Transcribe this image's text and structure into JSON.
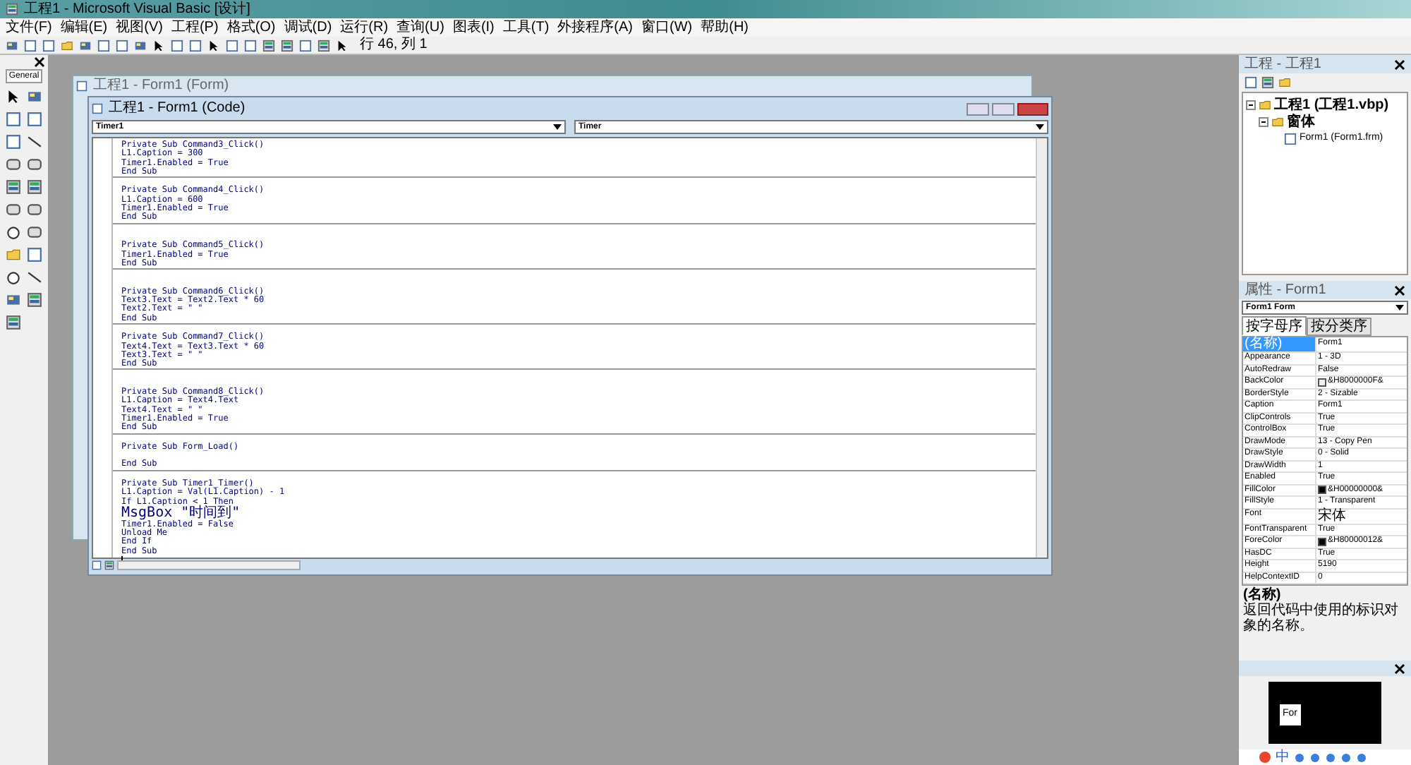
{
  "app": {
    "title": "工程1 - Microsoft Visual Basic [设计]"
  },
  "menu": [
    "文件(F)",
    "编辑(E)",
    "视图(V)",
    "工程(P)",
    "格式(O)",
    "调试(D)",
    "运行(R)",
    "查询(U)",
    "图表(I)",
    "工具(T)",
    "外接程序(A)",
    "窗口(W)",
    "帮助(H)"
  ],
  "toolbar": {
    "position": "行 46, 列 1"
  },
  "toolbox": {
    "tab": "General"
  },
  "form_window": {
    "title": "工程1 - Form1 (Form)"
  },
  "code_window": {
    "title": "工程1 - Form1 (Code)",
    "object_combo": "Timer1",
    "procedure_combo": "Timer",
    "procedures": [
      {
        "lines": [
          {
            "kind": "code",
            "text": "Private Sub Command3_Click()"
          },
          {
            "kind": "code",
            "text": "L1.Caption = 300"
          },
          {
            "kind": "code",
            "text": "Timer1.Enabled = True"
          },
          {
            "kind": "code",
            "text": "End Sub"
          }
        ]
      },
      {
        "lines": [
          {
            "kind": "blank"
          },
          {
            "kind": "code",
            "text": "Private Sub Command4_Click()"
          },
          {
            "kind": "code",
            "text": "L1.Caption = 600"
          },
          {
            "kind": "code",
            "text": "Timer1.Enabled = True"
          },
          {
            "kind": "code",
            "text": "End Sub"
          }
        ]
      },
      {
        "lines": [
          {
            "kind": "blank"
          },
          {
            "kind": "blank"
          },
          {
            "kind": "code",
            "text": "Private Sub Command5_Click()"
          },
          {
            "kind": "code",
            "text": "Timer1.Enabled = True"
          },
          {
            "kind": "code",
            "text": "End Sub"
          }
        ]
      },
      {
        "lines": [
          {
            "kind": "blank"
          },
          {
            "kind": "blank"
          },
          {
            "kind": "code",
            "text": "Private Sub Command6_Click()"
          },
          {
            "kind": "code",
            "text": "Text3.Text = Text2.Text * 60"
          },
          {
            "kind": "code",
            "text": "Text2.Text = \" \""
          },
          {
            "kind": "code",
            "text": "End Sub"
          }
        ]
      },
      {
        "lines": [
          {
            "kind": "blank"
          },
          {
            "kind": "code",
            "text": "Private Sub Command7_Click()"
          },
          {
            "kind": "code",
            "text": "Text4.Text = Text3.Text * 60"
          },
          {
            "kind": "code",
            "text": "Text3.Text = \" \""
          },
          {
            "kind": "code",
            "text": "End Sub"
          }
        ]
      },
      {
        "lines": [
          {
            "kind": "blank"
          },
          {
            "kind": "blank"
          },
          {
            "kind": "code",
            "text": "Private Sub Command8_Click()"
          },
          {
            "kind": "code",
            "text": "L1.Caption = Text4.Text"
          },
          {
            "kind": "code",
            "text": "Text4.Text = \" \""
          },
          {
            "kind": "code",
            "text": "Timer1.Enabled = True"
          },
          {
            "kind": "code",
            "text": "End Sub"
          }
        ]
      },
      {
        "lines": [
          {
            "kind": "blank"
          },
          {
            "kind": "code",
            "text": "Private Sub Form_Load()"
          },
          {
            "kind": "blank"
          },
          {
            "kind": "code",
            "text": "End Sub"
          }
        ]
      },
      {
        "lines": [
          {
            "kind": "blank"
          },
          {
            "kind": "code",
            "text": "Private Sub Timer1_Timer()"
          },
          {
            "kind": "code",
            "text": "L1.Caption = Val(L1.Caption) - 1"
          },
          {
            "kind": "code",
            "text": "If L1.Caption < 1 Then"
          },
          {
            "kind": "code",
            "text": "MsgBox \"时间到\""
          },
          {
            "kind": "code",
            "text": "Timer1.Enabled = False"
          },
          {
            "kind": "code",
            "text": "Unload Me"
          },
          {
            "kind": "code",
            "text": "End If"
          },
          {
            "kind": "code",
            "text": "End Sub"
          },
          {
            "kind": "caret"
          }
        ]
      }
    ]
  },
  "project_explorer": {
    "title": "工程 - 工程1",
    "tree": [
      {
        "label": "工程1 (工程1.vbp)",
        "expanded": true,
        "children": [
          {
            "label": "窗体",
            "expanded": true,
            "children": [
              {
                "label": "Form1 (Form1.frm)"
              }
            ]
          }
        ]
      }
    ]
  },
  "properties": {
    "title": "属性 - Form1",
    "object": "Form1 Form",
    "tabs": [
      {
        "label": "按字母序",
        "selected": true
      },
      {
        "label": "按分类序",
        "selected": false
      }
    ],
    "rows": [
      {
        "name": "(名称)",
        "value": "Form1",
        "selected": true
      },
      {
        "name": "Appearance",
        "value": "1 - 3D",
        "selected": false
      },
      {
        "name": "AutoRedraw",
        "value": "False",
        "selected": false
      },
      {
        "name": "BackColor",
        "value": "&H8000000F&",
        "color": "#f0f0f0",
        "selected": false
      },
      {
        "name": "BorderStyle",
        "value": "2 - Sizable",
        "selected": false
      },
      {
        "name": "Caption",
        "value": "Form1",
        "selected": false
      },
      {
        "name": "ClipControls",
        "value": "True",
        "selected": false
      },
      {
        "name": "ControlBox",
        "value": "True",
        "selected": false
      },
      {
        "name": "DrawMode",
        "value": "13 - Copy Pen",
        "selected": false
      },
      {
        "name": "DrawStyle",
        "value": "0 - Solid",
        "selected": false
      },
      {
        "name": "DrawWidth",
        "value": "1",
        "selected": false
      },
      {
        "name": "Enabled",
        "value": "True",
        "selected": false
      },
      {
        "name": "FillColor",
        "value": "&H00000000&",
        "color": "#000000",
        "selected": false
      },
      {
        "name": "FillStyle",
        "value": "1 - Transparent",
        "selected": false
      },
      {
        "name": "Font",
        "value": "宋体",
        "selected": false
      },
      {
        "name": "FontTransparent",
        "value": "True",
        "selected": false
      },
      {
        "name": "ForeColor",
        "value": "&H80000012&",
        "color": "#000000",
        "selected": false
      },
      {
        "name": "HasDC",
        "value": "True",
        "selected": false
      },
      {
        "name": "Height",
        "value": "5190",
        "selected": false
      },
      {
        "name": "HelpContextID",
        "value": "0",
        "selected": false
      }
    ],
    "description_title": "(名称)",
    "description": "返回代码中使用的标识对象的名称。"
  },
  "form_layout": {
    "form_label": "For"
  },
  "ime_bar": {
    "mode": "中"
  }
}
